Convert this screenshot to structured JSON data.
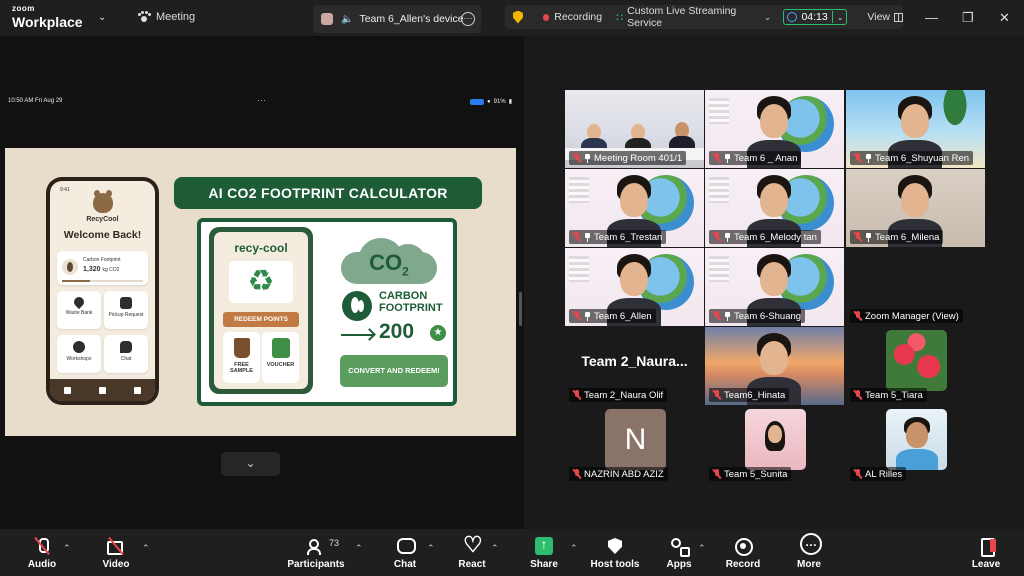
{
  "app": {
    "brand_small": "zoom",
    "brand_big": "Workplace"
  },
  "header": {
    "meeting_label": "Meeting",
    "device_tab_label": "Team 6_Allen's device",
    "recording_label": "Recording",
    "stream_label": "Custom Live Streaming Service",
    "timer": "04:13",
    "view_label": "View"
  },
  "shared": {
    "ipad_time": "10:50 AM  Fri Aug 29",
    "ipad_battery": "91%",
    "phone": {
      "time": "9:41",
      "app_name": "RecyCool",
      "welcome": "Welcome Back!",
      "cf_label": "Carbon Footprint",
      "cf_value": "1,320",
      "cf_unit": "kg CO2",
      "cf_progress": 0.35,
      "tiles": [
        "Waste Bank",
        "Pickup Request",
        "Workshops",
        "Chat"
      ]
    },
    "calc": {
      "title": "AI CO2 FOOTPRINT CALCULATOR",
      "app_title": "recy-cool",
      "redeem": "REDEEM POINTS",
      "tile1": "FREE SAMPLE",
      "tile2": "VOUCHER",
      "co2": "CO",
      "co2_sub": "2",
      "cf_line1": "CARBON",
      "cf_line2": "FOOTPRINT",
      "cf_num": "200",
      "convert": "CONVERT AND REDEEM!"
    }
  },
  "participants": [
    {
      "name": "Meeting Room 401/1",
      "bg": "room",
      "pinned": true
    },
    {
      "name": "Team 6 _ Anan",
      "bg": "earth",
      "pinned": true
    },
    {
      "name": "Team 6_Shuyuan Ren",
      "bg": "beach",
      "pinned": true
    },
    {
      "name": "Team 6_Trestan",
      "bg": "earth",
      "pinned": true
    },
    {
      "name": "Team 6_Melody tan",
      "bg": "earth",
      "pinned": true,
      "active": true
    },
    {
      "name": "Team 6_Milena",
      "bg": "wall",
      "pinned": true
    },
    {
      "name": "Team 6_Allen",
      "bg": "earth",
      "pinned": true
    },
    {
      "name": "Team 6-Shuang",
      "bg": "earth",
      "pinned": true
    },
    {
      "name": "Zoom Manager (View)",
      "bg": "none"
    },
    {
      "name": "Team 2_Naura Olif",
      "bg": "none",
      "big_text": "Team  2_Naura..."
    },
    {
      "name": "Team6_Hinata",
      "bg": "sunset"
    },
    {
      "name": "Team 5_Tiara",
      "bg": "flower"
    },
    {
      "name": "NAZRIN ABD AZIZ",
      "bg": "letter",
      "letter": "N"
    },
    {
      "name": "Team 5_Sunita",
      "bg": "pinkthumb"
    },
    {
      "name": "AL Rilles",
      "bg": "manthumb"
    }
  ],
  "toolbar": {
    "audio": "Audio",
    "video": "Video",
    "participants": "Participants",
    "participants_count": "73",
    "chat": "Chat",
    "react": "React",
    "share": "Share",
    "host_tools": "Host tools",
    "apps": "Apps",
    "record": "Record",
    "more": "More",
    "leave": "Leave"
  }
}
